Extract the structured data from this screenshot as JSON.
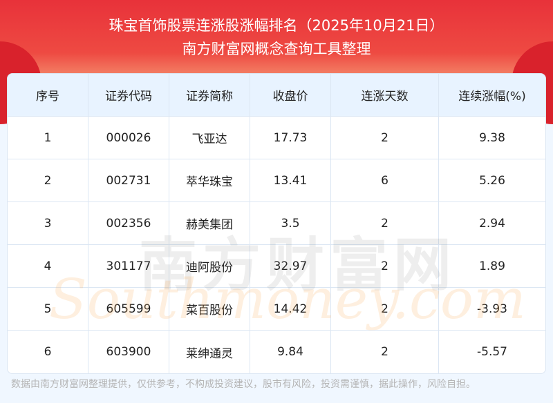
{
  "header": {
    "title": "珠宝首饰股票连涨股涨幅排名（2025年10月21日）",
    "subtitle": "南方财富网概念查询工具整理"
  },
  "table": {
    "columns": [
      "序号",
      "证券代码",
      "证券简称",
      "收盘价",
      "连涨天数",
      "连续涨幅(%)"
    ],
    "rows": [
      [
        "1",
        "000026",
        "飞亚达",
        "17.73",
        "2",
        "9.38"
      ],
      [
        "2",
        "002731",
        "萃华珠宝",
        "13.41",
        "6",
        "5.26"
      ],
      [
        "3",
        "002356",
        "赫美集团",
        "3.5",
        "2",
        "2.94"
      ],
      [
        "4",
        "301177",
        "迪阿股份",
        "32.97",
        "2",
        "1.89"
      ],
      [
        "5",
        "605599",
        "菜百股份",
        "14.42",
        "2",
        "-3.93"
      ],
      [
        "6",
        "603900",
        "莱绅通灵",
        "9.84",
        "2",
        "-5.57"
      ]
    ]
  },
  "watermark": {
    "cn": "南方财富网",
    "en": "Southmoney.com"
  },
  "footer": "数据由南方财富网整理提供，仅供参考，不构成投资建议，股市有风险，投资需谨慎，据此操作，风险自担。"
}
